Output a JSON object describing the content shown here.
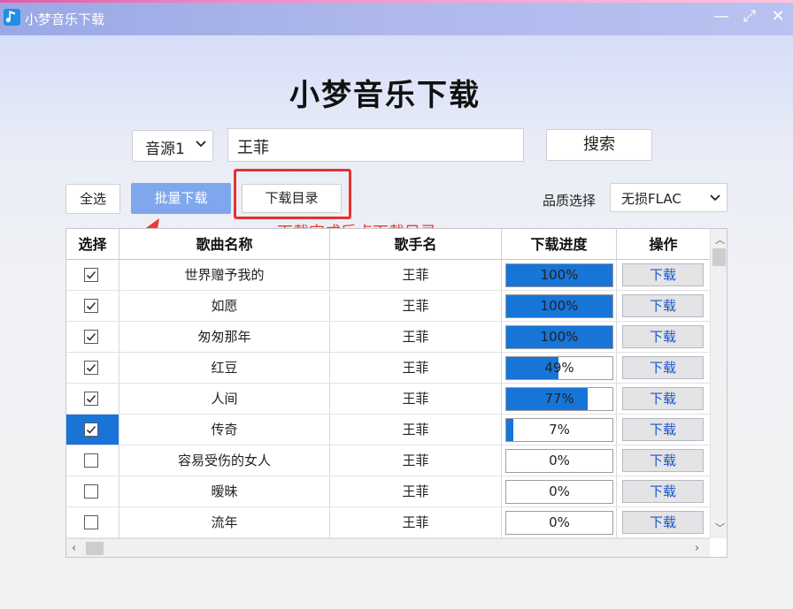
{
  "window": {
    "title": "小梦音乐下载",
    "buttons": {
      "minimize": "—",
      "maximize": "⤢",
      "close": "✕"
    }
  },
  "header": {
    "title": "小梦音乐下载"
  },
  "search": {
    "source_selected": "音源1",
    "query_value": "王菲",
    "search_label": "搜索"
  },
  "toolbar": {
    "select_all_label": "全选",
    "batch_download_label": "批量下载",
    "download_dir_label": "下载目录",
    "quality_label": "品质选择",
    "quality_selected": "无损FLAC"
  },
  "annotation": {
    "text": "下载完成后点下载目录",
    "color": "#ef3b31"
  },
  "table": {
    "headers": [
      "选择",
      "歌曲名称",
      "歌手名",
      "下载进度",
      "操作"
    ],
    "rows": [
      {
        "checked": true,
        "selected": false,
        "song": "世界赠予我的",
        "artist": "王菲",
        "progress": 100,
        "progress_label": "100%",
        "action": "下载"
      },
      {
        "checked": true,
        "selected": false,
        "song": "如愿",
        "artist": "王菲",
        "progress": 100,
        "progress_label": "100%",
        "action": "下载"
      },
      {
        "checked": true,
        "selected": false,
        "song": "匆匆那年",
        "artist": "王菲",
        "progress": 100,
        "progress_label": "100%",
        "action": "下载"
      },
      {
        "checked": true,
        "selected": false,
        "song": "红豆",
        "artist": "王菲",
        "progress": 49,
        "progress_label": "49%",
        "action": "下载"
      },
      {
        "checked": true,
        "selected": false,
        "song": "人间",
        "artist": "王菲",
        "progress": 77,
        "progress_label": "77%",
        "action": "下载"
      },
      {
        "checked": true,
        "selected": true,
        "song": "传奇",
        "artist": "王菲",
        "progress": 7,
        "progress_label": "7%",
        "action": "下载"
      },
      {
        "checked": false,
        "selected": false,
        "song": "容易受伤的女人",
        "artist": "王菲",
        "progress": 0,
        "progress_label": "0%",
        "action": "下载"
      },
      {
        "checked": false,
        "selected": false,
        "song": "暧昧",
        "artist": "王菲",
        "progress": 0,
        "progress_label": "0%",
        "action": "下载"
      },
      {
        "checked": false,
        "selected": false,
        "song": "流年",
        "artist": "王菲",
        "progress": 0,
        "progress_label": "0%",
        "action": "下载"
      }
    ]
  },
  "colors": {
    "accent": "#1775d8",
    "primary_button": "#7fa7ee",
    "action_text": "#1a55c8",
    "highlight": "#e4322b"
  },
  "icons": {
    "app": "music-note-icon",
    "source_dropdown": "chevron-down-icon",
    "quality_dropdown": "chevron-down-icon",
    "checkbox": "check-icon"
  }
}
